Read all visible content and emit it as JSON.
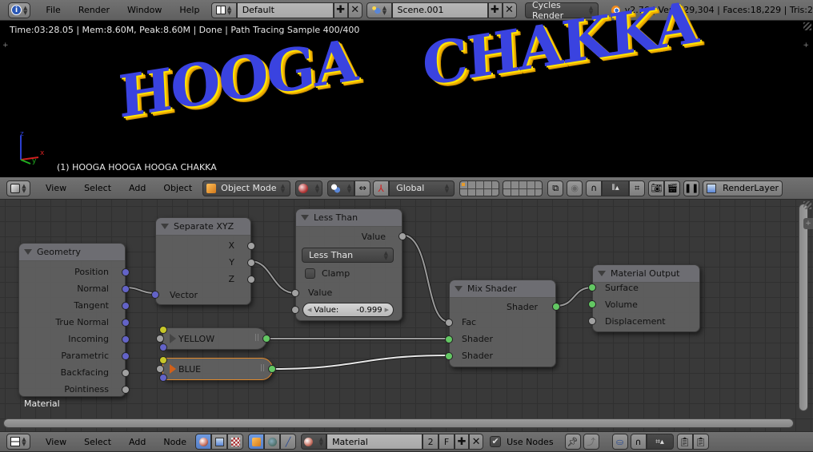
{
  "top_header": {
    "menus": [
      "File",
      "Render",
      "Window",
      "Help"
    ],
    "screen_layout": "Default",
    "scene": "Scene.001",
    "render_engine": "Cycles Render",
    "stats": "v2.76 | Verts:29,304 | Faces:18,229 | Tris:2"
  },
  "viewport": {
    "render_status": "Time:03:28.05 | Mem:8.60M, Peak:8.60M | Done | Path Tracing Sample 400/400",
    "object_label": "(1) HOOGA HOOGA HOOGA CHAKKA",
    "rendered_text": [
      "HOOGA",
      "CHAKKA"
    ],
    "axis_labels": {
      "x": "x",
      "y": "y",
      "z": "z"
    }
  },
  "view3d_header": {
    "menus": [
      "View",
      "Select",
      "Add",
      "Object"
    ],
    "mode": "Object Mode",
    "orientation": "Global",
    "render_layer": "RenderLayer"
  },
  "nodes": {
    "geometry": {
      "title": "Geometry",
      "outputs": [
        "Position",
        "Normal",
        "Tangent",
        "True Normal",
        "Incoming",
        "Parametric",
        "Backfacing",
        "Pointiness"
      ]
    },
    "separate_xyz": {
      "title": "Separate XYZ",
      "outputs": [
        "X",
        "Y",
        "Z"
      ],
      "inputs": [
        "Vector"
      ]
    },
    "less_than": {
      "title": "Less Than",
      "output": "Value",
      "operation": "Less Than",
      "clamp_label": "Clamp",
      "clamp_checked": false,
      "input_label": "Value",
      "value_label": "Value:",
      "value": "-0.999"
    },
    "yellow": {
      "title": "YELLOW"
    },
    "blue": {
      "title": "BLUE"
    },
    "mix_shader": {
      "title": "Mix Shader",
      "output": "Shader",
      "inputs": [
        "Fac",
        "Shader",
        "Shader"
      ]
    },
    "material_output": {
      "title": "Material Output",
      "inputs": [
        "Surface",
        "Volume",
        "Displacement"
      ]
    },
    "tree_label": "Material"
  },
  "node_header": {
    "menus": [
      "View",
      "Select",
      "Add",
      "Node"
    ],
    "material": "Material",
    "users": "2",
    "fake_user": "F",
    "use_nodes_label": "Use Nodes",
    "use_nodes_checked": true
  }
}
